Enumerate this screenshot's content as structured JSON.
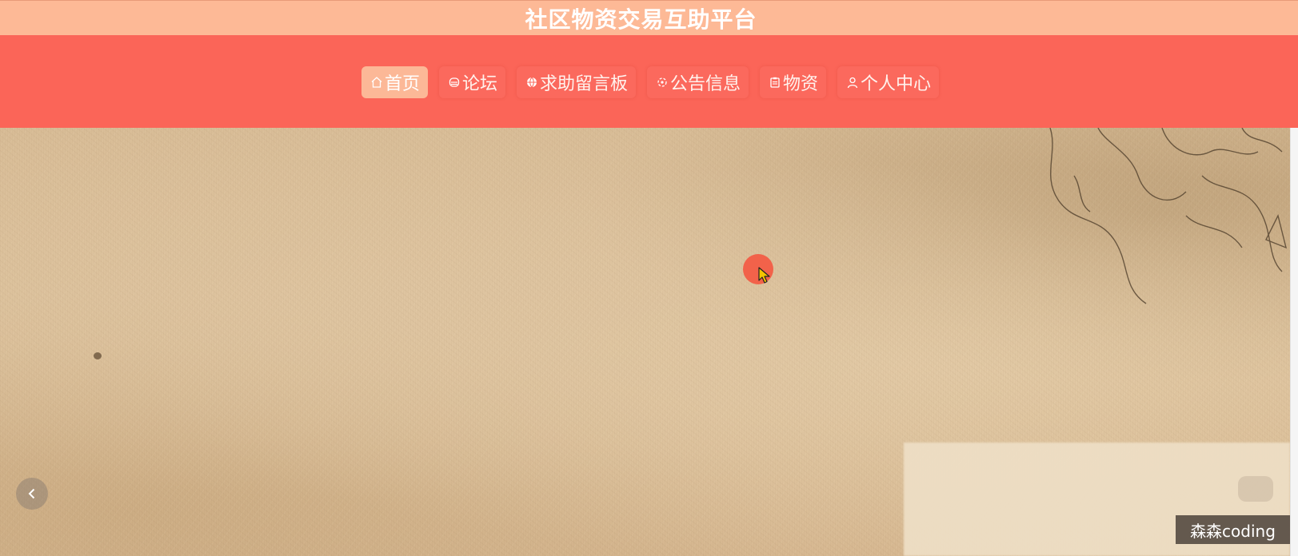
{
  "header": {
    "title": "社区物资交易互助平台"
  },
  "nav": {
    "items": [
      {
        "label": "首页",
        "icon": "home-icon",
        "active": true
      },
      {
        "label": "论坛",
        "icon": "forum-icon",
        "active": false
      },
      {
        "label": "求助留言板",
        "icon": "globe-icon",
        "active": false
      },
      {
        "label": "公告信息",
        "icon": "notice-icon",
        "active": false
      },
      {
        "label": "物资",
        "icon": "clipboard-icon",
        "active": false
      },
      {
        "label": "个人中心",
        "icon": "user-icon",
        "active": false
      }
    ]
  },
  "banner": {
    "prev_icon": "chevron-left-icon"
  },
  "watermark": {
    "text": "森森coding"
  },
  "colors": {
    "title_bar": "#fdb996",
    "nav_bar": "#fb6558",
    "nav_active": "#fcb897",
    "click_highlight": "#f2624a",
    "banner_base": "#d8bc96"
  }
}
